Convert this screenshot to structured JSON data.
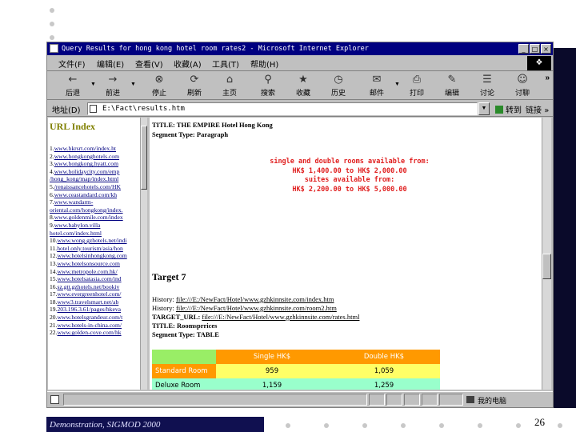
{
  "window": {
    "title": "Query Results for hong kong hotel room rates2 - Microsoft Internet Explorer",
    "controls": [
      "_",
      "□",
      "×"
    ]
  },
  "menu": {
    "items": [
      "文件(F)",
      "编辑(E)",
      "查看(V)",
      "收藏(A)",
      "工具(T)",
      "帮助(H)"
    ]
  },
  "toolbar": {
    "buttons": [
      {
        "icon": "back-arrow-icon",
        "glyph": "←",
        "label": "后退"
      },
      {
        "icon": "forward-arrow-icon",
        "glyph": "→",
        "label": "前进"
      },
      {
        "icon": "stop-icon",
        "glyph": "⊗",
        "label": "停止"
      },
      {
        "icon": "refresh-icon",
        "glyph": "⟳",
        "label": "刷新"
      },
      {
        "icon": "home-icon",
        "glyph": "⌂",
        "label": "主页"
      },
      {
        "icon": "search-icon",
        "glyph": "⚲",
        "label": "搜索"
      },
      {
        "icon": "favorites-icon",
        "glyph": "★",
        "label": "收藏"
      },
      {
        "icon": "history-icon",
        "glyph": "◷",
        "label": "历史"
      },
      {
        "icon": "mail-icon",
        "glyph": "✉",
        "label": "邮件"
      },
      {
        "icon": "print-icon",
        "glyph": "⎙",
        "label": "打印"
      },
      {
        "icon": "edit-icon",
        "glyph": "✎",
        "label": "编辑"
      },
      {
        "icon": "discuss-icon",
        "glyph": "☰",
        "label": "讨论"
      },
      {
        "icon": "messenger-icon",
        "glyph": "☺",
        "label": "讨聊"
      }
    ]
  },
  "address": {
    "label": "地址(D)",
    "value": "E:\\Fact\\results.htm",
    "go_label": "转到",
    "links_label": "链接"
  },
  "left_frame": {
    "heading": "URL Index",
    "rows": [
      [
        "1.",
        "www.hkrsrt.com/index.ht"
      ],
      [
        "2.",
        "www.hongkonghotels.com"
      ],
      [
        "3.",
        "www.hongkong.hyatt.com"
      ],
      [
        "4.",
        "www.holidaycity.com/emp"
      ],
      [
        "",
        "/hong_kong/map/index.html"
      ],
      [
        "5.",
        "/renaissancehotels.com/HK"
      ],
      [
        "6.",
        "www.ceastandard.com/kh"
      ],
      [
        "7.",
        "www.wandarm-"
      ],
      [
        "",
        "oriental.com/hongkong/index."
      ],
      [
        "8.",
        "www.goldenmile.com/index"
      ],
      [
        "9.",
        "www.babylon.villa"
      ],
      [
        "",
        "hotel.com/index.html"
      ],
      [
        "10.",
        "www.wong.gzhotels.net/indi"
      ],
      [
        "11.",
        "hotel.only.tourism/asia/hon"
      ],
      [
        "12.",
        "www.hotelsinhongkong.com"
      ],
      [
        "13.",
        "www.hotelsonsource.com"
      ],
      [
        "14.",
        "www.metropole.com.hk/"
      ],
      [
        "15.",
        "www.hotelsatasia.com/ind"
      ],
      [
        "16.",
        "sz.gtt.gzhotels.net/bookiv"
      ],
      [
        "17.",
        "www.evergreenhotel.com/"
      ],
      [
        "18.",
        "www3.travelsmart.net/ab"
      ],
      [
        "19.",
        "203.196.3.61/pages/hkeva"
      ],
      [
        "20.",
        "www.hotelsgrandeur.com/t"
      ],
      [
        "21.",
        "www.hotels-in-china.com/"
      ],
      [
        "22.",
        "www.golden-cove.com/hk"
      ]
    ]
  },
  "right_frame": {
    "title_line": "TITLE: THE EMPIRE Hotel Hong Kong",
    "segment_line": "Segment Type: Paragraph",
    "red_lines": [
      "single and double rooms available from:",
      "HK$ 1,400.00 to HK$ 2,000.00",
      "suites available from:",
      "HK$ 2,200.00 to HK$ 5,000.00"
    ],
    "target_heading": "Target 7",
    "history_lines": [
      {
        "label": "History:",
        "value": "file:///E:/NewFact/Hotel/www.gzhkinnsite.com/index.htm"
      },
      {
        "label": "History:",
        "value": "file:///E:/NewFact/Hotel/www.gzhkinnsite.com/room2.htm"
      },
      {
        "label": "TARGET_URL:",
        "value": "file:///E:/NewFact/Hotel/www.gzhkinnsite.com/rates.html"
      }
    ],
    "title_line2": "TITLE: Roomsprrices",
    "segment_line2": "Segment Type: TABLE",
    "table": {
      "headers": [
        "",
        "Single HK$",
        "Double HK$"
      ],
      "rows": [
        [
          "Standard Room",
          "959",
          "1,059"
        ],
        [
          "Deluxe Room",
          "1,159",
          "1,259"
        ]
      ]
    }
  },
  "status": {
    "zone": "我的电脑"
  },
  "footer": {
    "text": "Demonstration, SIGMOD 2000",
    "page_number": "26"
  },
  "colors": {
    "title_bar": "#000080",
    "red_text": "#e02020",
    "table_header_green": "#99ee66",
    "table_header_orange": "#ff9900",
    "table_yellow": "#ffff66",
    "table_lightgreen": "#99ffcc"
  }
}
